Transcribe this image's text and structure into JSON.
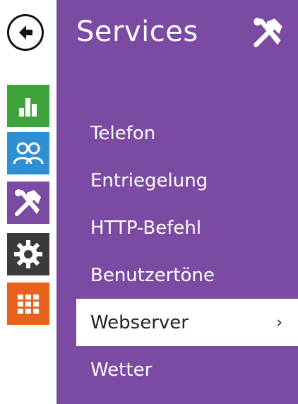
{
  "nav": {
    "back_icon": "back-arrow-icon",
    "tiles": [
      {
        "name": "status",
        "icon": "bar-chart-icon",
        "color": "#3da33a"
      },
      {
        "name": "users",
        "icon": "users-icon",
        "color": "#2e8fd4"
      },
      {
        "name": "services",
        "icon": "tools-icon",
        "color": "#7b4aa2"
      },
      {
        "name": "settings",
        "icon": "gear-icon",
        "color": "#3a3a3a"
      },
      {
        "name": "apps",
        "icon": "grid-icon",
        "color": "#e8611d"
      }
    ]
  },
  "panel": {
    "title": "Services",
    "title_icon": "tools-icon",
    "color": "#7b4aa2"
  },
  "menu": {
    "items": [
      {
        "label": "Telefon"
      },
      {
        "label": "Entriegelung"
      },
      {
        "label": "HTTP-Befehl"
      },
      {
        "label": "Benutzertöne"
      },
      {
        "label": "Webserver",
        "active": true,
        "chevron": "›"
      },
      {
        "label": "Wetter"
      }
    ]
  }
}
